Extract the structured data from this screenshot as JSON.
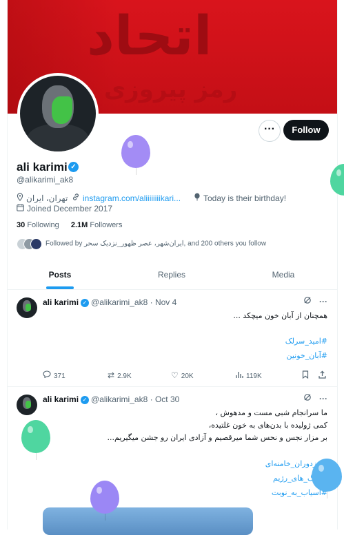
{
  "profile": {
    "banner_text_large": "اتحاد",
    "banner_text_small": "رمز پیروزی",
    "name": "ali karimi",
    "handle": "@alikarimi_ak8",
    "location": "تهران، ایران",
    "website": "instagram.com/aliiiiiiiikari...",
    "birthday": "Today is their birthday!",
    "joined": "Joined December 2017",
    "following_count": "30",
    "following_label": "Following",
    "followers_count": "2.1M",
    "followers_label": "Followers",
    "followed_by": "Followed by ایران‌شهر، عصر ظهور_نزدیک سحر, and 200 others you follow",
    "follow_button": "Follow",
    "more_button": "···"
  },
  "tabs": [
    "Posts",
    "Replies",
    "Media"
  ],
  "tweets": [
    {
      "name": "ali karimi",
      "handle": "@alikarimi_ak8",
      "date": "Nov 4",
      "lines": [
        "همچنان از آبان خون میچکد ..."
      ],
      "hashtags": [
        "#امید_سرلک",
        "#آبان_خونین"
      ],
      "replies": "371",
      "retweets": "2.9K",
      "likes": "20K",
      "views": "119K"
    },
    {
      "name": "ali karimi",
      "handle": "@alikarimi_ak8",
      "date": "Oct 30",
      "lines": [
        "ما سرانجام شبی مست و مدهوش ،",
        "کمی ژولیده با بدن‌های به خون غلتیده،",
        "بر مزار نجس و نحس شما میرقصیم و آزادی ایران رو جشن میگیریم..."
      ],
      "hashtags": [
        "#مزدوران_خامنه‌ای",
        "#جنگ_های_رژیم",
        "#اسیاب_به_نوبت"
      ]
    }
  ],
  "separator": "·",
  "colors": {
    "accent": "#1d9bf0",
    "banner": "#d9141c",
    "balloon_purple": "#9b87f5",
    "balloon_green": "#4fd6a0",
    "balloon_blue": "#5ab4f0"
  }
}
